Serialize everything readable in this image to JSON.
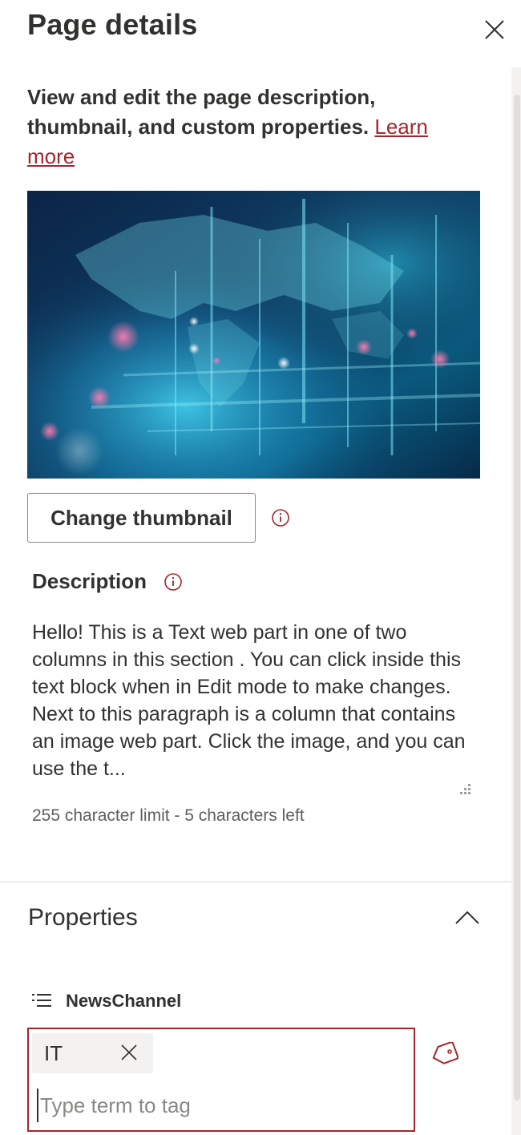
{
  "panel": {
    "title": "Page details",
    "intro_text": "View and edit the page description, thumbnail, and custom properties. ",
    "learn_more": "Learn more"
  },
  "thumbnail": {
    "change_label": "Change thumbnail"
  },
  "description": {
    "label": "Description",
    "text": "Hello! This is a Text web part in one of two columns in this section . You can click inside this text block when in Edit mode to make changes. Next to this paragraph is a column that contains an image web part. Click the image, and you can use the t...",
    "char_limit": "255 character limit - 5 characters left"
  },
  "properties": {
    "title": "Properties",
    "field_label": "NewsChannel",
    "tags": [
      "IT"
    ],
    "input_placeholder": "Type term to tag"
  },
  "colors": {
    "accent": "#a4262c",
    "text": "#323130",
    "muted": "#605e5c"
  },
  "icons": [
    "close-icon",
    "info-icon",
    "chevron-up-icon",
    "list-icon",
    "tag-icon",
    "remove-icon"
  ]
}
